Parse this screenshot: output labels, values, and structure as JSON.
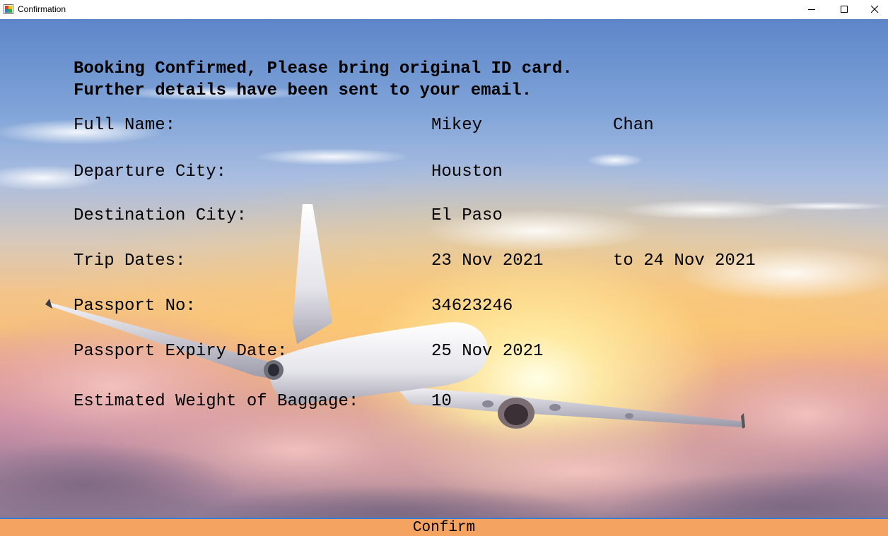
{
  "window": {
    "title": "Confirmation",
    "controls": [
      "minimize-icon",
      "maximize-icon",
      "close-icon"
    ]
  },
  "headline": {
    "line1": "Booking Confirmed, Please bring original ID card.",
    "line2": "Further details have been sent to your email."
  },
  "details": {
    "full_name": {
      "label": "Full Name:",
      "first": "Mikey",
      "last": "Chan"
    },
    "departure_city": {
      "label": "Departure City:",
      "value": "Houston"
    },
    "destination_city": {
      "label": "Destination City:",
      "value": "El Paso"
    },
    "trip_dates": {
      "label": "Trip Dates:",
      "start": "23 Nov 2021",
      "end": "to 24 Nov 2021"
    },
    "passport_no": {
      "label": "Passport No:",
      "value": "34623246"
    },
    "passport_expiry": {
      "label": "Passport Expiry Date:",
      "value": "25 Nov 2021"
    },
    "baggage_weight": {
      "label": "Estimated Weight of Baggage:",
      "value": "10"
    }
  },
  "confirm_button": {
    "label": "Confirm"
  },
  "colors": {
    "confirm_bg": "#f4a460",
    "confirm_border": "#3b7bd4"
  }
}
